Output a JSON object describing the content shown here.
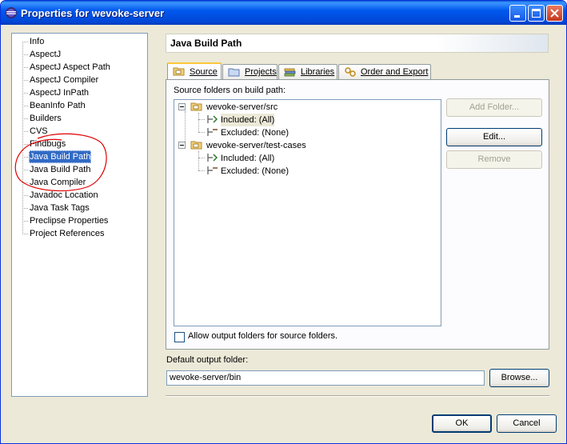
{
  "window": {
    "title": "Properties for wevoke-server",
    "controls": [
      "minimize-icon",
      "maximize-icon",
      "close-icon"
    ]
  },
  "sidebar": {
    "items": [
      {
        "label": "Info"
      },
      {
        "label": "AspectJ"
      },
      {
        "label": "AspectJ Aspect Path"
      },
      {
        "label": "AspectJ Compiler"
      },
      {
        "label": "AspectJ InPath"
      },
      {
        "label": "BeanInfo Path"
      },
      {
        "label": "Builders"
      },
      {
        "label": "CVS"
      },
      {
        "label": "Findbugs"
      },
      {
        "label": "Java Build Path",
        "selected": true
      },
      {
        "label": "Java Build Path"
      },
      {
        "label": "Java Compiler"
      },
      {
        "label": "Javadoc Location"
      },
      {
        "label": "Java Task Tags"
      },
      {
        "label": "Preclipse Properties"
      },
      {
        "label": "Project References"
      }
    ]
  },
  "page": {
    "title": "Java Build Path",
    "tabs": [
      {
        "label": "Source",
        "icon": "folder-source-icon",
        "active": true
      },
      {
        "label": "Projects",
        "icon": "project-icon"
      },
      {
        "label": "Libraries",
        "icon": "libraries-icon"
      },
      {
        "label": "Order and Export",
        "icon": "order-export-icon"
      }
    ],
    "source_label": "Source folders on build path:",
    "tree": [
      {
        "label": "wevoke-server/src",
        "expanded": true,
        "children": [
          {
            "label": "Included: (All)",
            "highlighted": true
          },
          {
            "label": "Excluded: (None)"
          }
        ]
      },
      {
        "label": "wevoke-server/test-cases",
        "expanded": true,
        "children": [
          {
            "label": "Included: (All)"
          },
          {
            "label": "Excluded: (None)"
          }
        ]
      }
    ],
    "buttons": {
      "add_folder": "Add Folder...",
      "edit": "Edit...",
      "remove": "Remove"
    },
    "allow_output_label": "Allow output folders for source folders.",
    "allow_output_checked": false,
    "default_output_label": "Default output folder:",
    "default_output_value": "wevoke-server/bin",
    "browse": "Browse..."
  },
  "footer": {
    "ok": "OK",
    "cancel": "Cancel"
  },
  "colors": {
    "titlebar": "#0058ee",
    "selection": "#316ac5",
    "annotation": "#e00000",
    "dialog_bg": "#ece9d8"
  }
}
